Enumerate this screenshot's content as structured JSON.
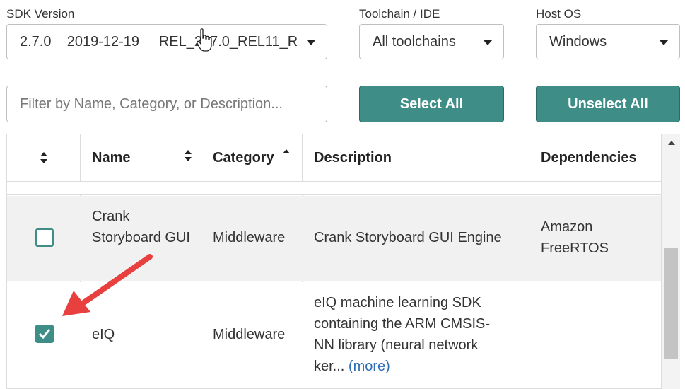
{
  "filters": {
    "sdk_version": {
      "label": "SDK Version",
      "value": "2.7.0    2019-12-19     REL_2_7.0_REL11_R"
    },
    "toolchain": {
      "label": "Toolchain / IDE",
      "value": "All toolchains"
    },
    "host_os": {
      "label": "Host OS",
      "value": "Windows"
    }
  },
  "search": {
    "placeholder": "Filter by Name, Category, or Description..."
  },
  "buttons": {
    "select_all": "Select All",
    "unselect_all": "Unselect All"
  },
  "table": {
    "columns": [
      "",
      "Name",
      "Category",
      "Description",
      "Dependencies"
    ],
    "rows": [
      {
        "checked": false,
        "name": "Crank Storyboard GUI",
        "category": "Middleware",
        "description": "Crank Storyboard GUI Engine",
        "dependencies": "Amazon FreeRTOS"
      },
      {
        "checked": true,
        "name": "eIQ",
        "category": "Middleware",
        "description": "eIQ machine learning SDK containing the ARM CMSIS-NN library (neural network ker...",
        "more_link": "(more)",
        "dependencies": ""
      }
    ]
  },
  "colors": {
    "accent": "#3e8e87",
    "link": "#2f6fb5",
    "annotation_arrow": "#e8403f"
  }
}
